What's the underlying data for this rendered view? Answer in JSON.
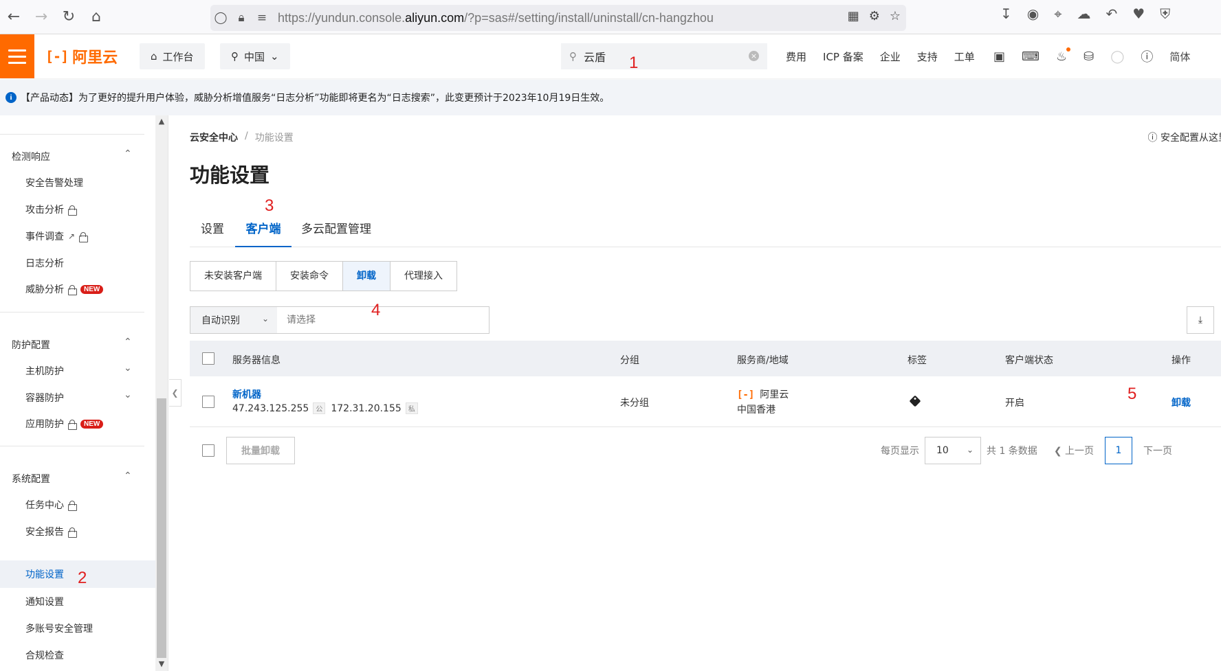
{
  "browser": {
    "url_prefix": "https://yundun.console.",
    "url_domain": "aliyun.com",
    "url_suffix": "/?p=sas#/setting/install/uninstall/cn-hangzhou"
  },
  "header": {
    "logo": "阿里云",
    "workbench": "工作台",
    "region": "中国",
    "search_value": "云盾",
    "links": [
      "费用",
      "ICP 备案",
      "企业",
      "支持",
      "工单"
    ],
    "lang": "简体",
    "accent_color": "#ff6a00"
  },
  "notice": {
    "text": "【产品动态】为了更好的提升用户体验，威胁分析增值服务“日志分析”功能即将更名为“日志搜索”，此变更预计于2023年10月19日生效。"
  },
  "sidebar": {
    "groups": [
      {
        "title": "检测响应",
        "items": [
          "安全告警处理",
          "攻击分析",
          "事件调查",
          "日志分析",
          "威胁分析"
        ]
      },
      {
        "title": "防护配置",
        "items": [
          "主机防护",
          "容器防护",
          "应用防护"
        ]
      },
      {
        "title": "系统配置",
        "items": [
          "任务中心",
          "安全报告",
          "功能设置",
          "通知设置",
          "多账号安全管理",
          "合规检查"
        ]
      }
    ],
    "new_badge": "NEW",
    "active_item": "功能设置"
  },
  "main": {
    "breadcrumb": [
      "云安全中心",
      "功能设置"
    ],
    "help_link": "安全配置从这里",
    "title": "功能设置",
    "tabs": [
      "设置",
      "客户端",
      "多云配置管理"
    ],
    "active_tab": "客户端",
    "segments": [
      "未安装客户端",
      "安装命令",
      "卸载",
      "代理接入"
    ],
    "active_segment": "卸载",
    "filter": {
      "select": "自动识别",
      "placeholder": "请选择"
    },
    "table": {
      "headers": [
        "服务器信息",
        "分组",
        "服务商/地域",
        "标签",
        "客户端状态",
        "操作"
      ],
      "rows": [
        {
          "name": "新机器",
          "public_ip": "47.243.125.255",
          "public_tag": "公",
          "private_ip": "172.31.20.155",
          "private_tag": "私",
          "group": "未分组",
          "provider": "阿里云",
          "region": "中国香港",
          "status": "开启",
          "action": "卸载"
        }
      ]
    },
    "batch_button": "批量卸载",
    "pager": {
      "per_page_label": "每页显示",
      "per_page": "10",
      "total": "共 1 条数据",
      "prev": "上一页",
      "current": "1",
      "next": "下一页"
    }
  },
  "annotations": [
    "1",
    "2",
    "3",
    "4",
    "5"
  ],
  "link_color": "#0064c8"
}
